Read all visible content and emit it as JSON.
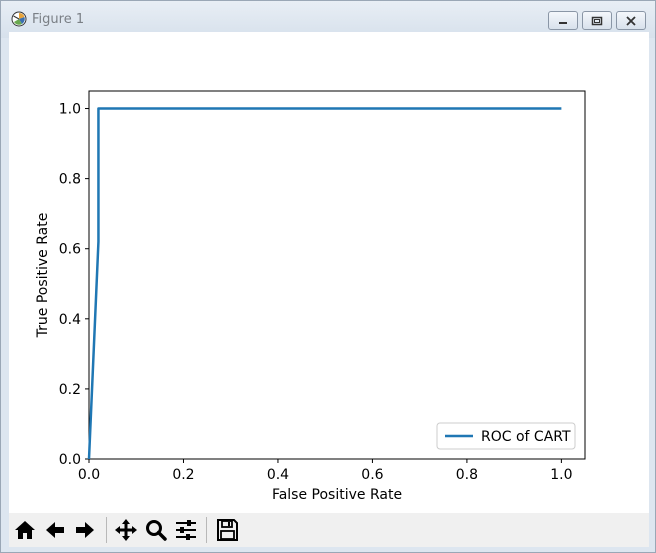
{
  "window": {
    "title": "Figure 1",
    "icon": "matplotlib-figure-icon",
    "controls": [
      "minimize-icon",
      "restore-icon",
      "close-icon"
    ]
  },
  "toolbar": {
    "buttons": [
      {
        "name": "home",
        "icon": "home-icon"
      },
      {
        "name": "back",
        "icon": "arrow-left-icon"
      },
      {
        "name": "forward",
        "icon": "arrow-right-icon"
      },
      {
        "name": "pan",
        "icon": "move-icon"
      },
      {
        "name": "zoom",
        "icon": "magnifier-icon"
      },
      {
        "name": "configure-subplots",
        "icon": "sliders-icon"
      },
      {
        "name": "save",
        "icon": "floppy-disk-icon"
      }
    ]
  },
  "chart_data": {
    "type": "line",
    "title": "",
    "xlabel": "False Positive Rate",
    "ylabel": "True Positive Rate",
    "xlim": [
      0.0,
      1.05
    ],
    "ylim": [
      0.0,
      1.05
    ],
    "xticks": [
      "0.0",
      "0.2",
      "0.4",
      "0.6",
      "0.8",
      "1.0"
    ],
    "yticks": [
      "0.0",
      "0.2",
      "0.4",
      "0.6",
      "0.8",
      "1.0"
    ],
    "grid": false,
    "legend_position": "lower-right",
    "series": [
      {
        "name": "ROC of CART",
        "color": "#1f77b4",
        "x": [
          0.0,
          0.02,
          0.02,
          1.0
        ],
        "y": [
          0.0,
          0.62,
          1.0,
          1.0
        ]
      }
    ]
  }
}
